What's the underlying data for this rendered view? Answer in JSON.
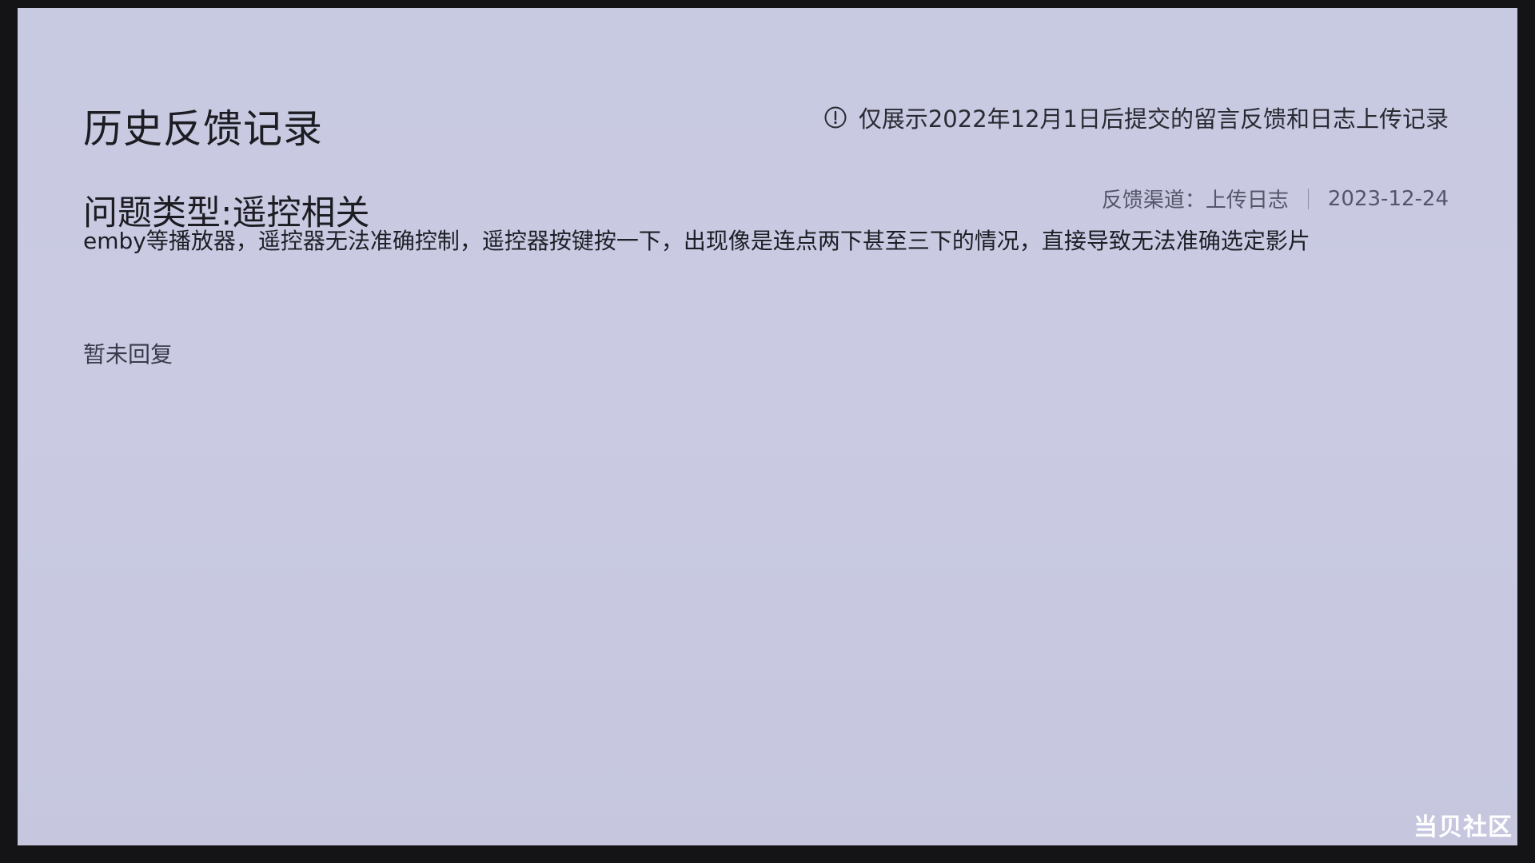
{
  "header": {
    "title": "历史反馈记录",
    "notice_icon": "info-circle-icon",
    "notice": "仅展示2022年12月1日后提交的留言反馈和日志上传记录"
  },
  "feedback": {
    "title": "问题类型:遥控相关",
    "channel": "反馈渠道：上传日志",
    "date": "2023-12-24",
    "content": "emby等播放器，遥控器无法准确控制，遥控器按键按一下，出现像是连点两下甚至三下的情况，直接导致无法准确选定影片",
    "reply_status": "暂未回复"
  },
  "watermark": "当贝社区"
}
